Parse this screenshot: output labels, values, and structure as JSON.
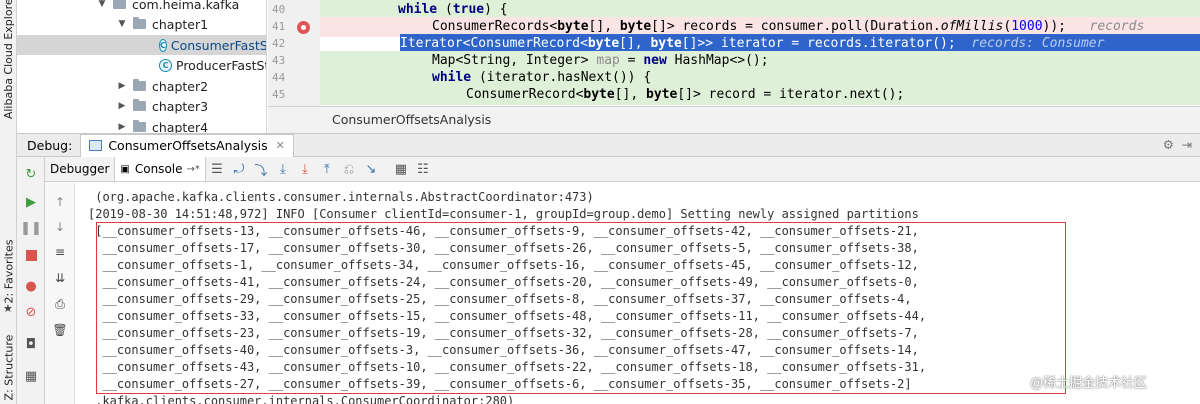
{
  "sidebar_tabs": {
    "cloud_explorer": "Alibaba Cloud Explorer",
    "favorites": "2: Favorites",
    "structure": "Z: Structure"
  },
  "tree": {
    "package": "com.heima.kafka",
    "folder_chapter1": "chapter1",
    "file_selected": "ConsumerFastSt",
    "file_producer": "ProducerFastSta",
    "folder_chapter2": "chapter2",
    "folder_chapter3": "chapter3",
    "folder_chapter4": "chapter4",
    "class_icon_letter": "C"
  },
  "editor": {
    "line_numbers": [
      "40",
      "41",
      "42",
      "43",
      "44",
      "45"
    ],
    "line40": {
      "kw": "while",
      "rest_open": " (",
      "kw2": "true",
      "rest_close": ") {"
    },
    "line41": {
      "pre": "ConsumerRecords<",
      "kw_a": "byte",
      "mid": "[], ",
      "kw_b": "byte",
      "post": "[]> records = consumer.poll(Duration.",
      "method": "ofMillis",
      "open": "(",
      "num": "1000",
      "close": "));",
      "hint": "records"
    },
    "line42": {
      "pre": "Iterator<ConsumerRecord<",
      "kw_a": "byte",
      "mid": "[], ",
      "kw_b": "byte",
      "post": "[]>> iterator = records.iterator();",
      "hint": "records: Consumer"
    },
    "line43": {
      "pre": "Map<String, Integer> ",
      "var": "map",
      "eq": " = ",
      "kw": "new",
      "post": " HashMap<>();"
    },
    "line44": {
      "kw": "while",
      "post": " (iterator.hasNext()) {"
    },
    "line45": {
      "pre": "ConsumerRecord<",
      "kw_a": "byte",
      "mid": "[], ",
      "kw_b": "byte",
      "post": "[]> record = iterator.next();"
    },
    "tab_title": "ConsumerOffsetsAnalysis"
  },
  "debug": {
    "label": "Debug:",
    "session_tab": "ConsumerOffsetsAnalysis",
    "debugger_tab": "Debugger",
    "console_tab": "Console",
    "console_tab_suffix": "→*"
  },
  "console_lines": [
    " (org.apache.kafka.clients.consumer.internals.AbstractCoordinator:473)",
    "[2019-08-30 14:51:48,972] INFO [Consumer clientId=consumer-1, groupId=group.demo] Setting newly assigned partitions",
    " [__consumer_offsets-13, __consumer_offsets-46, __consumer_offsets-9, __consumer_offsets-42, __consumer_offsets-21,",
    "  __consumer_offsets-17, __consumer_offsets-30, __consumer_offsets-26, __consumer_offsets-5, __consumer_offsets-38,",
    "  __consumer_offsets-1, __consumer_offsets-34, __consumer_offsets-16, __consumer_offsets-45, __consumer_offsets-12,",
    "  __consumer_offsets-41, __consumer_offsets-24, __consumer_offsets-20, __consumer_offsets-49, __consumer_offsets-0,",
    "  __consumer_offsets-29, __consumer_offsets-25, __consumer_offsets-8, __consumer_offsets-37, __consumer_offsets-4,",
    "  __consumer_offsets-33, __consumer_offsets-15, __consumer_offsets-48, __consumer_offsets-11, __consumer_offsets-44,",
    "  __consumer_offsets-23, __consumer_offsets-19, __consumer_offsets-32, __consumer_offsets-28, __consumer_offsets-7,",
    "  __consumer_offsets-40, __consumer_offsets-3, __consumer_offsets-36, __consumer_offsets-47, __consumer_offsets-14,",
    "  __consumer_offsets-43, __consumer_offsets-10, __consumer_offsets-22, __consumer_offsets-18, __consumer_offsets-31,",
    "  __consumer_offsets-27, __consumer_offsets-39, __consumer_offsets-6, __consumer_offsets-35, __consumer_offsets-2]",
    " .kafka.clients.consumer.internals.ConsumerCoordinator:280)"
  ],
  "watermark": "@稀土掘金技术社区",
  "colors": {
    "selection_blue": "#2f65ca",
    "execution_green": "#dff0d8",
    "breakpoint_pink": "#fbe4e4",
    "annotation_red": "#e23b3b"
  }
}
